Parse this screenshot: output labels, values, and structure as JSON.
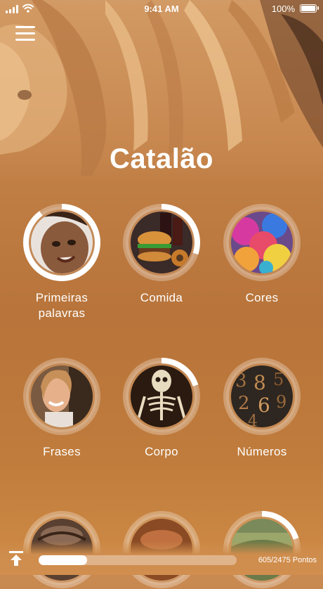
{
  "status_bar": {
    "time": "9:41 AM",
    "battery": "100%"
  },
  "page": {
    "title": "Catalão"
  },
  "categories": [
    {
      "label": "Primeiras palavras",
      "progress": 0.9
    },
    {
      "label": "Comida",
      "progress": 0.3
    },
    {
      "label": "Cores",
      "progress": 0.0
    },
    {
      "label": "Frases",
      "progress": 0.0
    },
    {
      "label": "Corpo",
      "progress": 0.2
    },
    {
      "label": "Números",
      "progress": 0.0
    },
    {
      "label": "",
      "progress": 0.0
    },
    {
      "label": "",
      "progress": 0.0
    },
    {
      "label": "",
      "progress": 0.2
    }
  ],
  "footer": {
    "points_text": "605/2475 Pontos",
    "progress": 0.2444
  },
  "icons": {
    "menu": "hamburger-menu-icon",
    "upload": "upload-arrow-icon",
    "wifi": "wifi-icon",
    "signal": "cellular-signal-icon",
    "battery": "battery-icon"
  }
}
